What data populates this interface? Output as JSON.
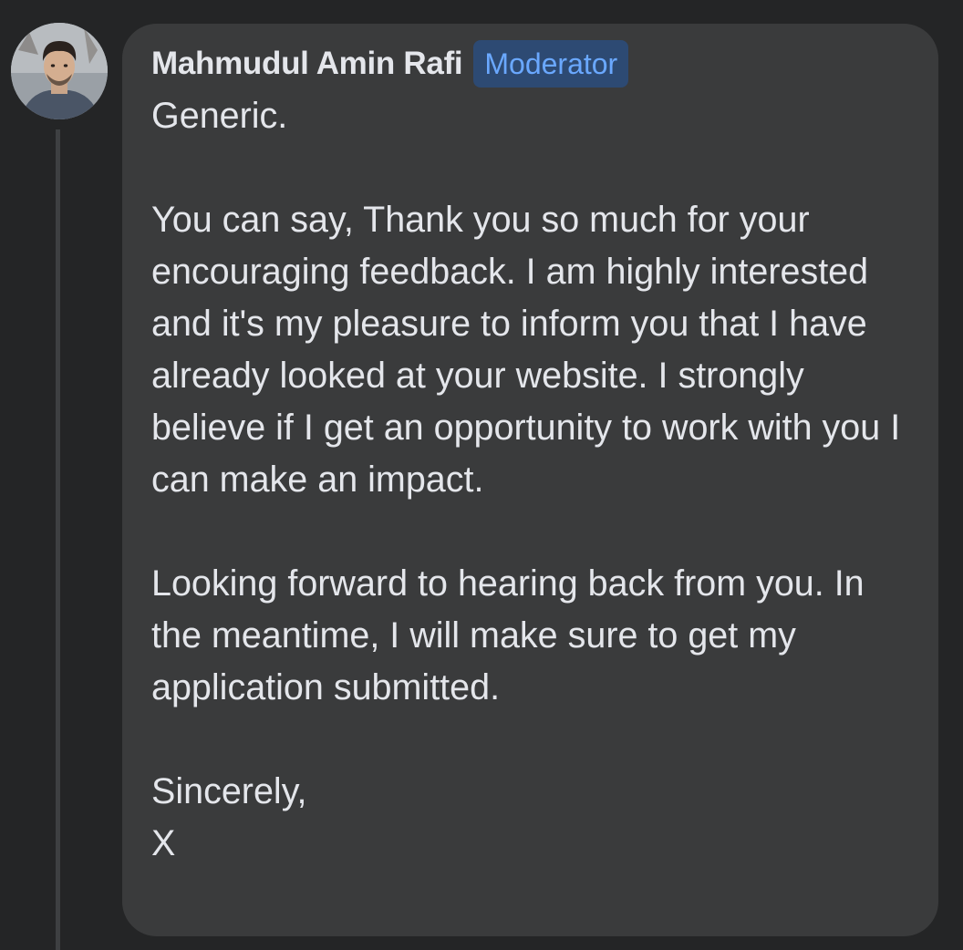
{
  "comment": {
    "author": "Mahmudul Amin Rafi",
    "badge": "Moderator",
    "paragraphs": [
      "Generic.",
      "You can say,  Thank you so much for your encouraging feedback. I am highly interested and it's my pleasure to inform you that I have already looked at your website. I strongly believe if I get an opportunity to work with you I can make an impact.",
      "Looking forward to hearing back from you. In the meantime, I will make sure to get my application submitted."
    ],
    "signoff": "Sincerely,",
    "signature": "X"
  },
  "colors": {
    "background": "#242526",
    "bubble": "#3a3b3c",
    "text": "#e4e6eb",
    "badge_bg": "#2d4a73",
    "badge_text": "#6aa8ff"
  }
}
